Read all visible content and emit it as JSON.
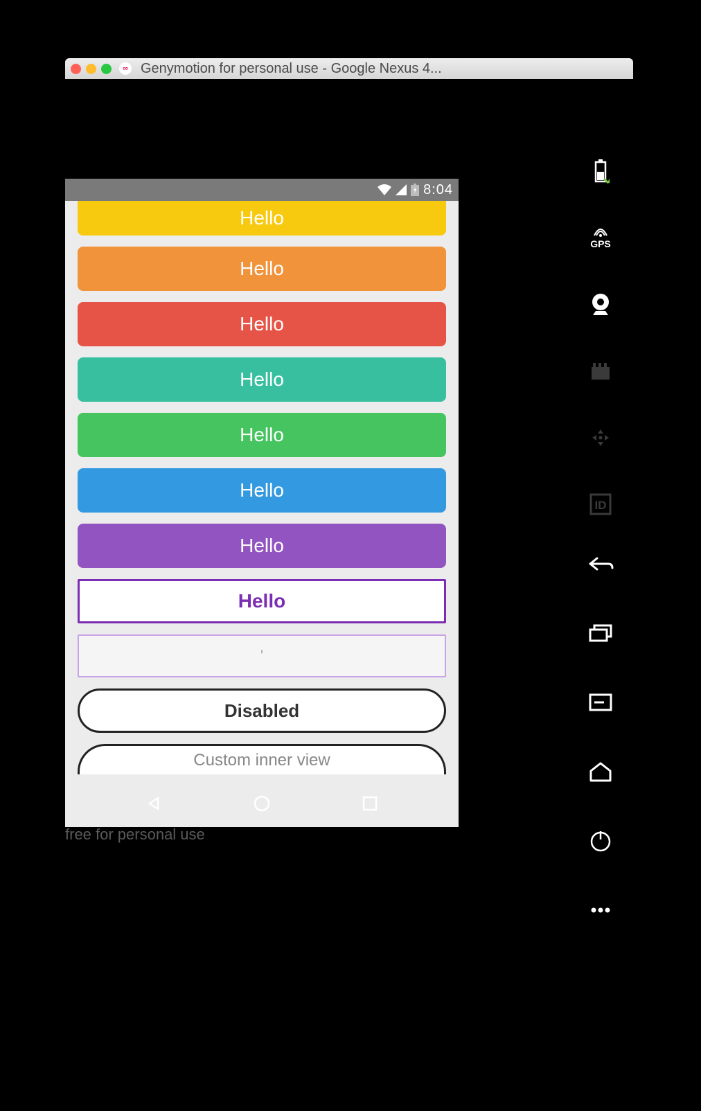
{
  "window": {
    "title": "Genymotion for personal use - Google Nexus 4..."
  },
  "status_bar": {
    "time": "8:04"
  },
  "buttons": [
    {
      "label": "Hello",
      "color": "amber"
    },
    {
      "label": "Hello",
      "color": "orange"
    },
    {
      "label": "Hello",
      "color": "red"
    },
    {
      "label": "Hello",
      "color": "teal"
    },
    {
      "label": "Hello",
      "color": "green"
    },
    {
      "label": "Hello",
      "color": "blue"
    },
    {
      "label": "Hello",
      "color": "purple"
    },
    {
      "label": "Hello",
      "style": "outlined"
    },
    {
      "label": "'",
      "style": "outlined-light"
    },
    {
      "label": "Disabled",
      "style": "pill"
    },
    {
      "label": "Custom inner view",
      "style": "pill-light"
    }
  ],
  "footer": "free for personal use",
  "side_toolbar": {
    "gps_label": "GPS"
  }
}
